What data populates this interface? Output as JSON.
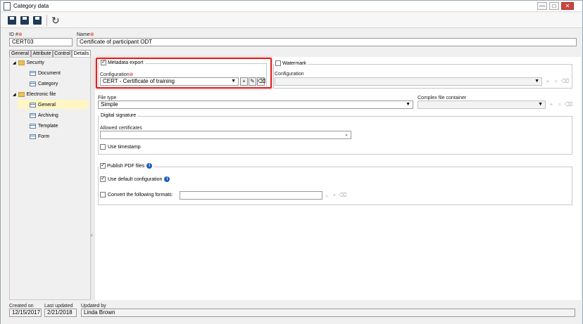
{
  "window": {
    "title": "Category data",
    "controls": {
      "minimize": "—",
      "maximize": "□",
      "close": "✕"
    }
  },
  "toolbar": {
    "buttons": [
      {
        "name": "save-icon"
      },
      {
        "name": "save-and-new-icon"
      },
      {
        "name": "save-and-close-icon"
      },
      {
        "name": "refresh-icon",
        "glyph": "↻"
      }
    ]
  },
  "header": {
    "id_label": "ID #",
    "id_value": "CERT03",
    "name_label": "Name",
    "name_value": "Certificate of participant ODT",
    "required_mark": "⊛"
  },
  "tabs": [
    "General",
    "Attribute",
    "Control",
    "Details"
  ],
  "active_tab": "Details",
  "tree": {
    "groups": [
      {
        "label": "Security",
        "children": [
          "Document",
          "Category"
        ]
      },
      {
        "label": "Electronic file",
        "children": [
          "General",
          "Archiving",
          "Template",
          "Form"
        ]
      }
    ],
    "selected": "General",
    "collapse_glyph": "◢"
  },
  "splitter_glyph": "‹",
  "metadata_export": {
    "checkbox_label": "Metadata export",
    "checked": true,
    "config_label": "Configuration",
    "config_value": "CERT - Certificate of training",
    "btn_add": "+",
    "btn_edit": "✎",
    "btn_clear": "⌫"
  },
  "watermark": {
    "checkbox_label": "Watermark",
    "checked": false,
    "config_label": "Configuration",
    "config_value": ""
  },
  "file_type": {
    "label": "File type",
    "value": "Simple"
  },
  "complex_container": {
    "label": "Complex file container",
    "value": ""
  },
  "digital_signature": {
    "legend": "Digital signature",
    "allowed_label": "Allowed certificates",
    "allowed_value": "",
    "timestamp_label": "Use timestamp",
    "timestamp_checked": false
  },
  "publish_pdf": {
    "label": "Publish PDF files",
    "checked": true,
    "default_config_label": "Use default configuration",
    "default_config_checked": true,
    "convert_label": "Convert the following formats:",
    "convert_checked": false,
    "convert_value": "",
    "info_glyph": "i"
  },
  "footer": {
    "created_label": "Created on",
    "created_value": "12/15/2017",
    "updated_label": "Last updated",
    "updated_value": "2/21/2018",
    "updated_by_label": "Updated by",
    "updated_by_value": "Linda Brown"
  },
  "colors": {
    "highlight": "#e02020",
    "tree_selection": "#fff6c4",
    "info": "#1b5fc1"
  }
}
